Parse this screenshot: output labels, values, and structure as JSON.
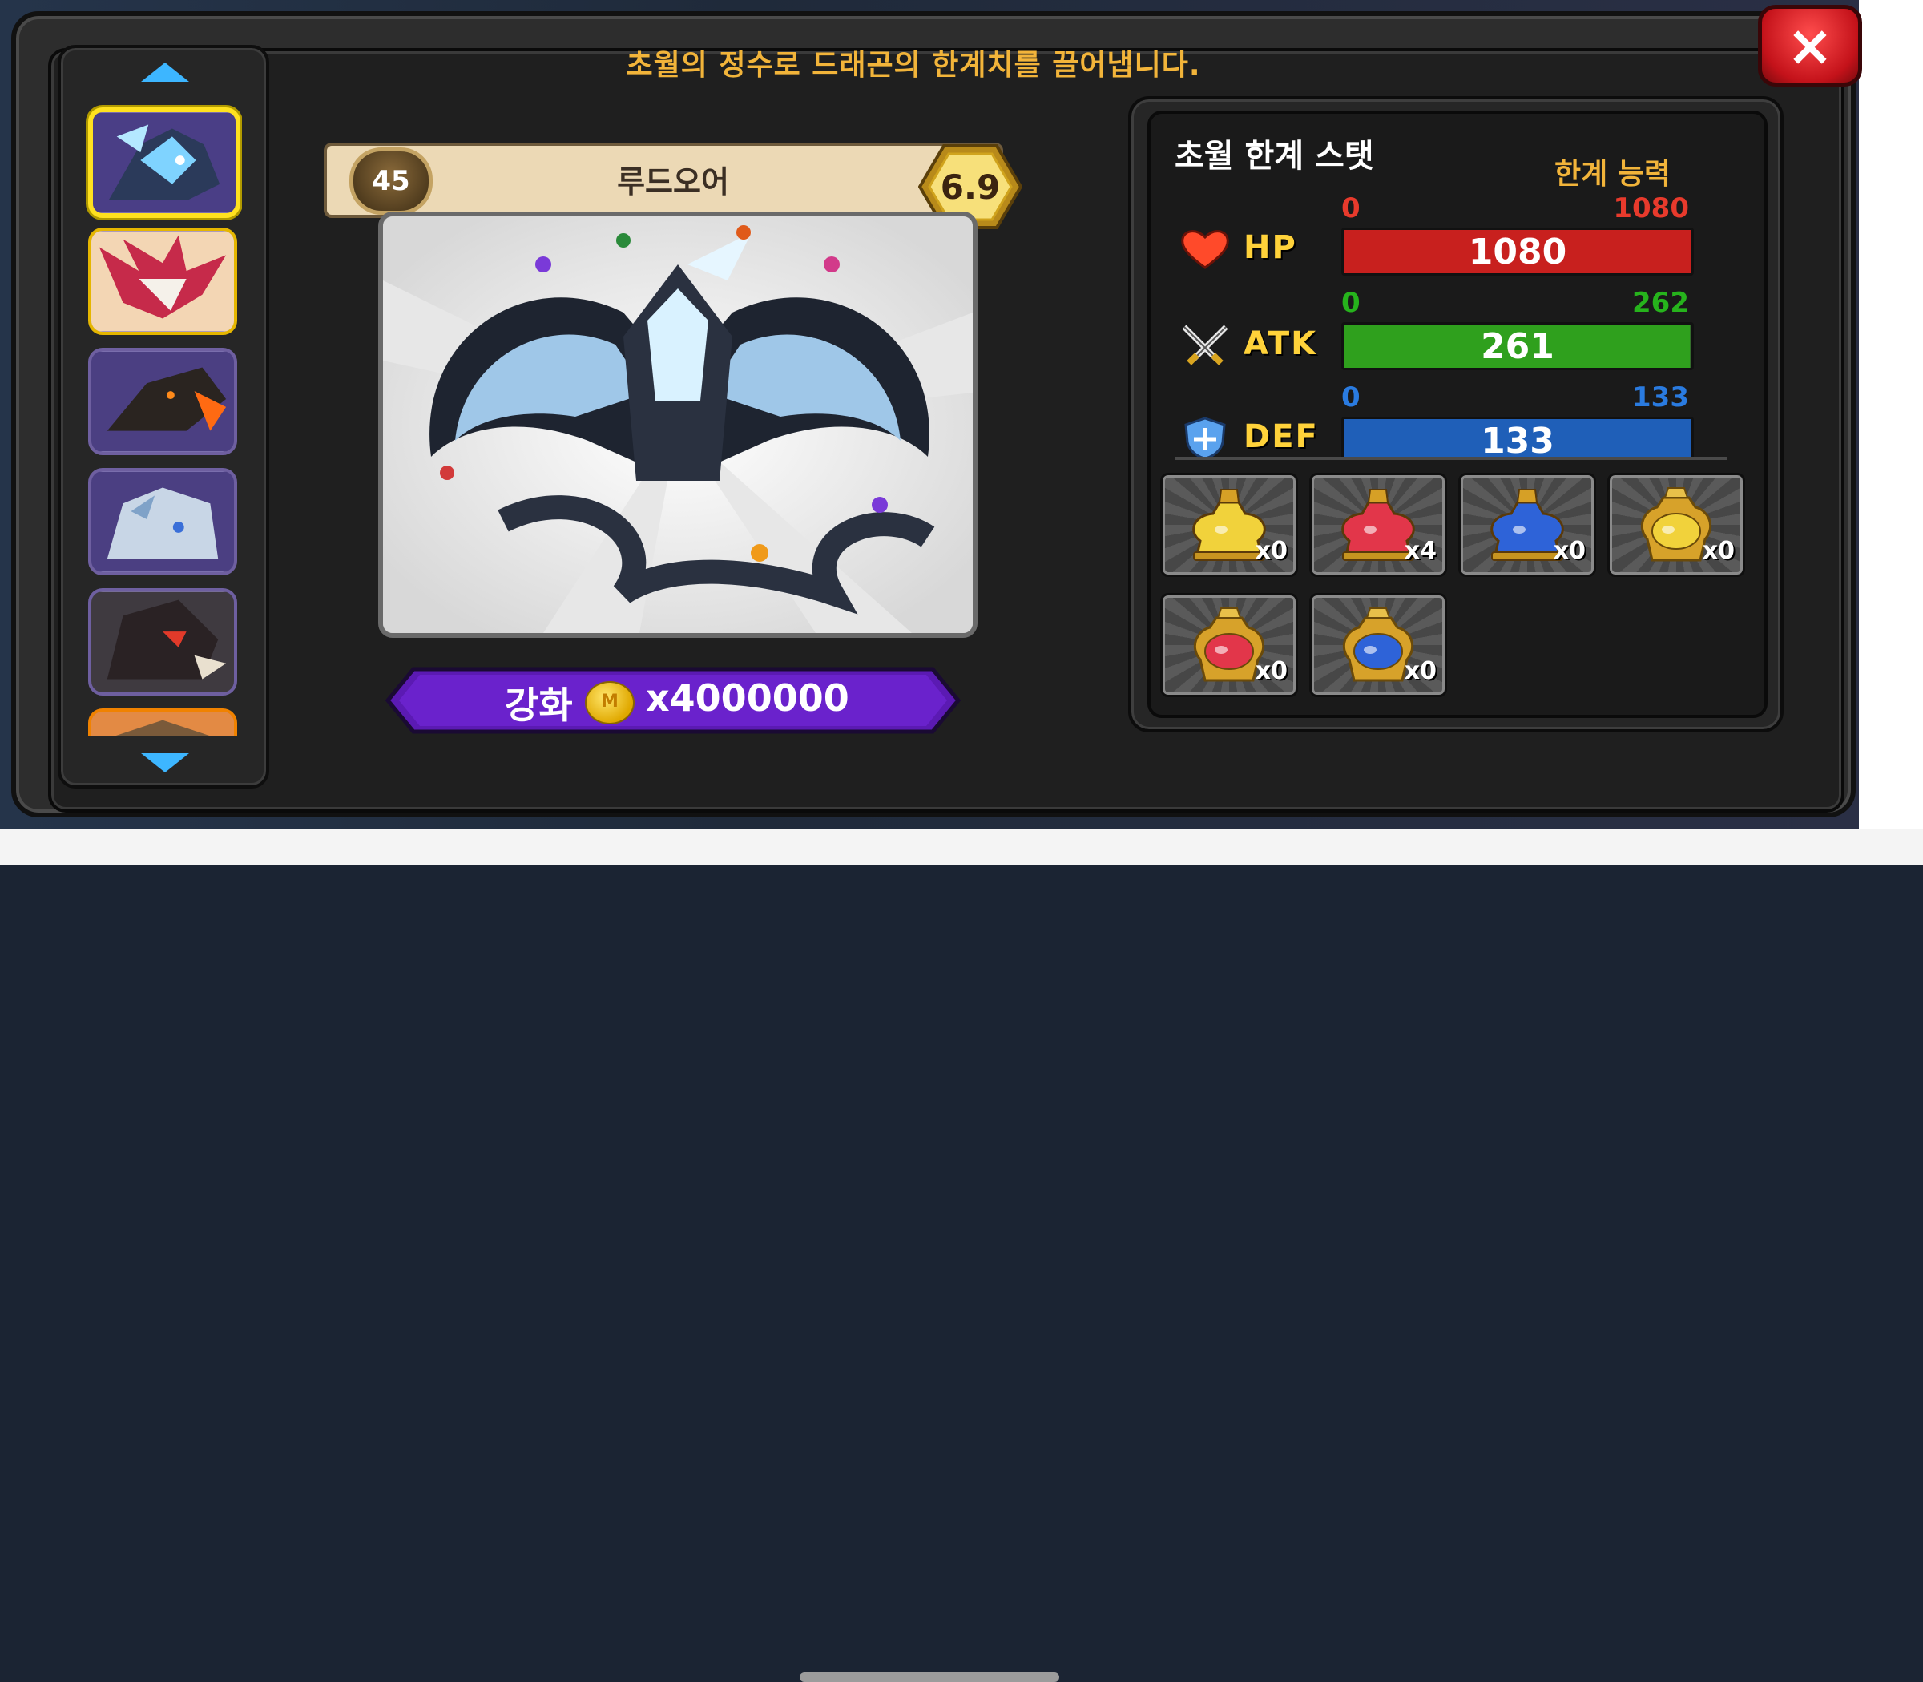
{
  "header": {
    "message": "초월의 정수로 드래곤의 한계치를 끌어냅니다.",
    "close_icon": "×"
  },
  "sidebar": {
    "slots": [
      {
        "name": "slot-1",
        "theme": "blue-crystal",
        "selected": true
      },
      {
        "name": "slot-2",
        "theme": "red-pink"
      },
      {
        "name": "slot-3",
        "theme": "dark-orange"
      },
      {
        "name": "slot-4",
        "theme": "steel-white"
      },
      {
        "name": "slot-5",
        "theme": "dark-red"
      },
      {
        "name": "slot-6",
        "theme": "orange-partial"
      }
    ]
  },
  "dragon": {
    "level": "45",
    "name": "루드오어",
    "rating": "6.9"
  },
  "upgrade": {
    "label": "강화",
    "coin_symbol": "M",
    "cost": "x4000000"
  },
  "stats": {
    "title": "초월 한계 스탯",
    "limit_title": "한계 능력",
    "rows": [
      {
        "label": "HP",
        "icon": "heart-icon",
        "min": "0",
        "max": "1080",
        "value": "1080",
        "fill": 1.0,
        "bar_color": "#c8201e",
        "num_color": "#e83a2c"
      },
      {
        "label": "ATK",
        "icon": "crossed-swords-icon",
        "min": "0",
        "max": "262",
        "value": "261",
        "fill": 0.996,
        "bar_color": "#2fa01d",
        "num_color": "#26b31c"
      },
      {
        "label": "DEF",
        "icon": "shield-icon",
        "min": "0",
        "max": "133",
        "value": "133",
        "fill": 1.0,
        "bar_color": "#1f5fb8",
        "num_color": "#2a7be0"
      }
    ]
  },
  "potions": [
    {
      "name": "yellow-potion",
      "color": "#f1d23b",
      "count": "x0"
    },
    {
      "name": "red-potion",
      "color": "#e2364a",
      "count": "x4"
    },
    {
      "name": "blue-potion",
      "color": "#2e63d8",
      "count": "x0"
    },
    {
      "name": "gold-yellow-urn",
      "color": "#f1d23b",
      "count": "x0"
    },
    {
      "name": "gold-red-urn",
      "color": "#e2364a",
      "count": "x0"
    },
    {
      "name": "gold-blue-urn",
      "color": "#2e63d8",
      "count": "x0"
    }
  ]
}
